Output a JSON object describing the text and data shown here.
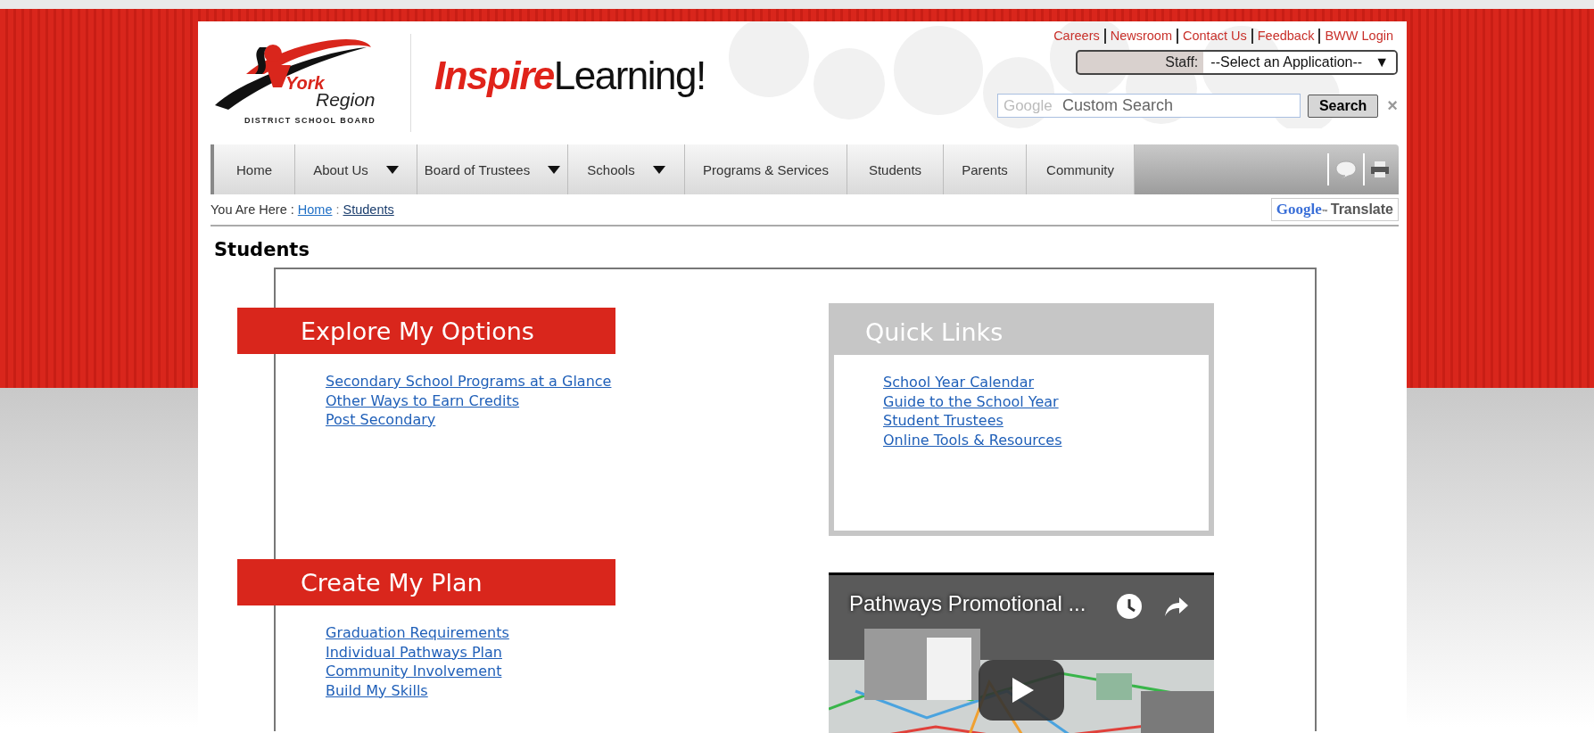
{
  "header": {
    "logo": {
      "name_bold": "York",
      "name_rest": "Region",
      "subtitle": "DISTRICT SCHOOL BOARD"
    },
    "brand": {
      "accent": "Inspire",
      "rest": "Learning!"
    },
    "top_links": [
      "Careers",
      "Newsroom",
      "Contact Us",
      "Feedback",
      "BWW Login"
    ],
    "staff": {
      "label": "Staff:",
      "value": "--Select an Application--",
      "caret": "▼"
    },
    "search": {
      "brand": "Google",
      "placeholder": "Custom Search",
      "button": "Search",
      "clear": "×"
    }
  },
  "nav": [
    {
      "label": "Home",
      "has_menu": false
    },
    {
      "label": "About Us",
      "has_menu": true
    },
    {
      "label": "Board of Trustees",
      "has_menu": true
    },
    {
      "label": "Schools",
      "has_menu": true
    },
    {
      "label": "Programs & Services",
      "has_menu": false
    },
    {
      "label": "Students",
      "has_menu": false
    },
    {
      "label": "Parents",
      "has_menu": false
    },
    {
      "label": "Community",
      "has_menu": false
    }
  ],
  "breadcrumb": {
    "prefix": "You Are Here :",
    "separator": ":",
    "links": [
      "Home",
      "Students"
    ]
  },
  "translate": {
    "brand": "Google",
    "mark": "™",
    "label": "Translate"
  },
  "page_title": "Students",
  "sections": [
    {
      "title": "Explore My Options",
      "links": [
        "Secondary School Programs at a Glance",
        "Other Ways to Earn Credits",
        "Post Secondary"
      ]
    },
    {
      "title": "Create My Plan",
      "links": [
        "Graduation Requirements",
        "Individual Pathways Plan",
        "Community Involvement",
        "Build My Skills"
      ]
    }
  ],
  "quick_links": {
    "title": "Quick Links",
    "links": [
      "School Year Calendar",
      "Guide to the School Year",
      "Student Trustees",
      "Online Tools & Resources"
    ]
  },
  "video": {
    "kind": "picture",
    "title": "Pathways Promotional ..."
  }
}
